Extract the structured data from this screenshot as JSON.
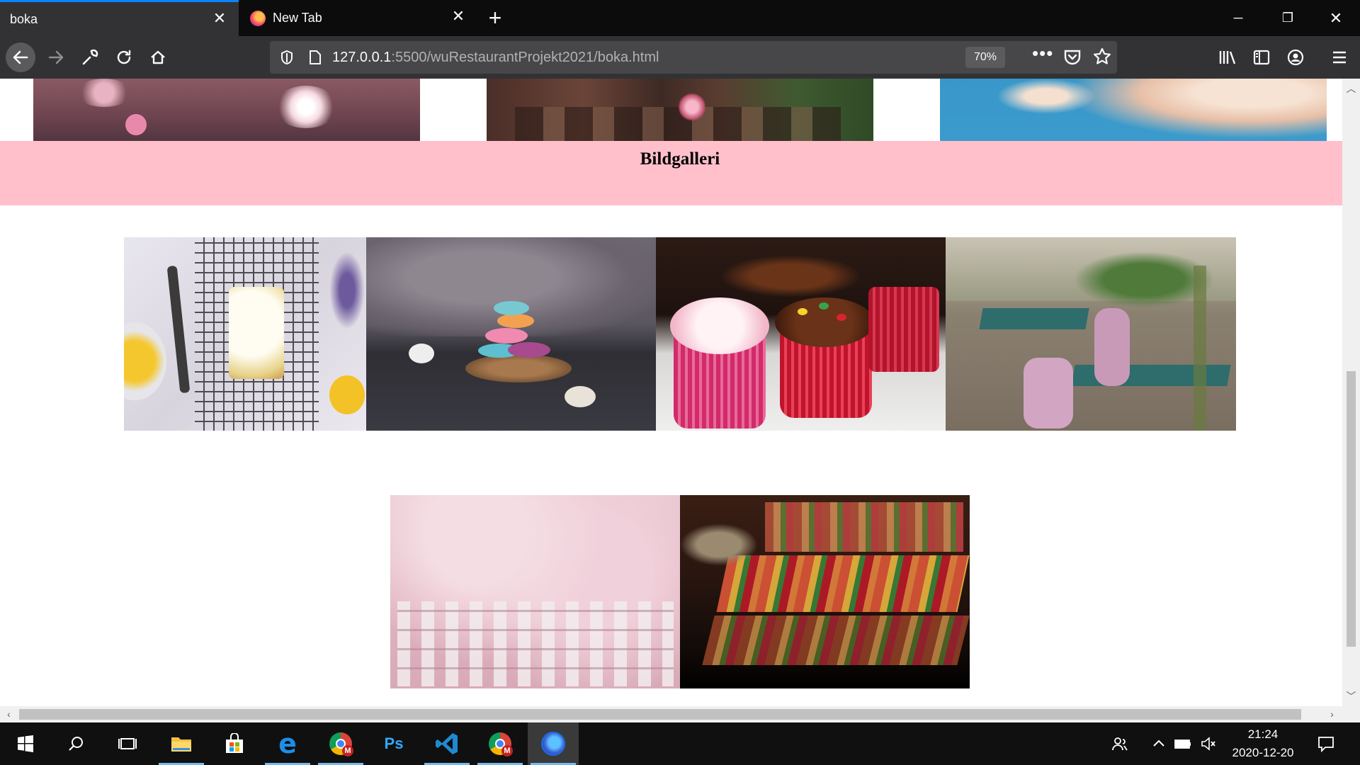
{
  "browser": {
    "tabs": [
      {
        "label": "boka",
        "active": true
      },
      {
        "label": "New Tab",
        "active": false
      }
    ],
    "url_host": "127.0.0.1",
    "url_rest": ":5500/wuRestaurantProjekt2021/boka.html",
    "zoom": "70%"
  },
  "page": {
    "heading": "Bildgalleri"
  },
  "taskbar": {
    "time": "21:24",
    "date": "2020-12-20",
    "apps": [
      "start-icon",
      "search-icon",
      "task-view-icon",
      "file-explorer-icon",
      "store-icon",
      "edge-icon",
      "chrome-icon",
      "photoshop-icon",
      "vscode-icon",
      "chrome-icon",
      "firefox-icon"
    ],
    "ps_label": "Ps"
  }
}
